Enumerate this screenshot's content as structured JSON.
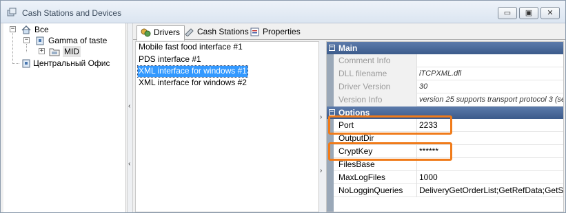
{
  "window": {
    "title": "Cash Stations and Devices",
    "buttons": {
      "minimize": "▭",
      "maximize": "▣",
      "close": "✕"
    }
  },
  "tree": {
    "root": "Все",
    "children": [
      {
        "label": "Gamma of taste",
        "children": [
          {
            "label": "MID"
          }
        ]
      },
      {
        "label": "Центральный Офис"
      }
    ]
  },
  "tabs": [
    {
      "label": "Drivers",
      "icon": "drivers-icon",
      "active": true
    },
    {
      "label": "Cash Stations",
      "icon": "cash-stations-icon",
      "active": false
    },
    {
      "label": "Properties",
      "icon": "properties-icon",
      "active": false
    }
  ],
  "drivers": [
    {
      "label": "Mobile fast food interface #1",
      "selected": false
    },
    {
      "label": "PDS interface #1",
      "selected": false
    },
    {
      "label": "XML interface for windows #1",
      "selected": true
    },
    {
      "label": "XML interface for windows #2",
      "selected": false
    }
  ],
  "property_grid": {
    "categories": [
      {
        "label": "Main",
        "rows": [
          {
            "name": "Comment Info",
            "value": "",
            "readonly": true
          },
          {
            "name": "DLL filename",
            "value": "iTCPXML.dll",
            "readonly": true
          },
          {
            "name": "Driver Version",
            "value": "30",
            "readonly": true
          },
          {
            "name": "Version Info",
            "value": "version 25 supports transport protocol 3 (se",
            "readonly": true
          }
        ]
      },
      {
        "label": "Options",
        "rows": [
          {
            "name": "Port",
            "value": "2233",
            "readonly": false,
            "highlighted": true
          },
          {
            "name": "OutputDir",
            "value": "",
            "readonly": false
          },
          {
            "name": "CryptKey",
            "value": "******",
            "readonly": false,
            "highlighted": true
          },
          {
            "name": "FilesBase",
            "value": "",
            "readonly": false
          },
          {
            "name": "MaxLogFiles",
            "value": "1000",
            "readonly": false
          },
          {
            "name": "NoLogginQueries",
            "value": "DeliveryGetOrderList;GetRefData;GetSyster",
            "readonly": false
          }
        ]
      }
    ]
  },
  "colors": {
    "selection": "#3399ff",
    "category_header": "#4a6a9a",
    "highlight_box": "#f07b1a"
  }
}
